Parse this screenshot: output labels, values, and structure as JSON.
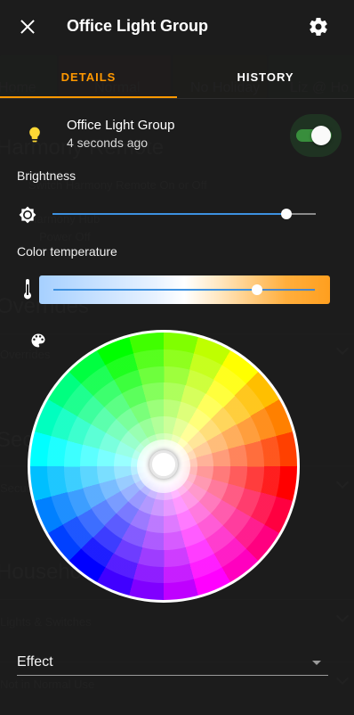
{
  "background": {
    "tiles": [
      "Home",
      "Normal",
      "No Holiday",
      "Liz @ Ho"
    ],
    "harmony_title": "Harmony Remote",
    "harmony_sub": "Switch Harmony Remote On or Off",
    "harmony_hub": "Harmony Hub",
    "power_off": "Power Off",
    "overrides_title": "Overrides",
    "overrides_row": "Overrides",
    "security_title": "Security",
    "security_row": "Security",
    "household_title": "Household",
    "lights_row": "Lights & Switches",
    "normal_use_row": "Not in Normal Use"
  },
  "dialog": {
    "title": "Office Light Group",
    "tabs": {
      "details": "DETAILS",
      "history": "HISTORY"
    },
    "entity": {
      "name": "Office Light Group",
      "last_changed": "4 seconds ago",
      "state_on": true
    },
    "brightness": {
      "label": "Brightness",
      "value_fraction": 0.89
    },
    "color_temperature": {
      "label": "Color temperature",
      "value_fraction": 0.78
    },
    "effect": {
      "label": "Effect",
      "selected": ""
    }
  },
  "icons": {
    "close": "close-icon",
    "settings": "gear-icon",
    "bulb": "lightbulb-icon",
    "brightness": "brightness-icon",
    "thermometer": "thermometer-icon",
    "palette": "palette-icon",
    "dropdown": "chevron-down-icon"
  },
  "colors": {
    "accent": "#ff9800",
    "bulb_on": "#fdd835",
    "toggle_on": "#388e3c",
    "slider_fill": "#3d91e0"
  }
}
